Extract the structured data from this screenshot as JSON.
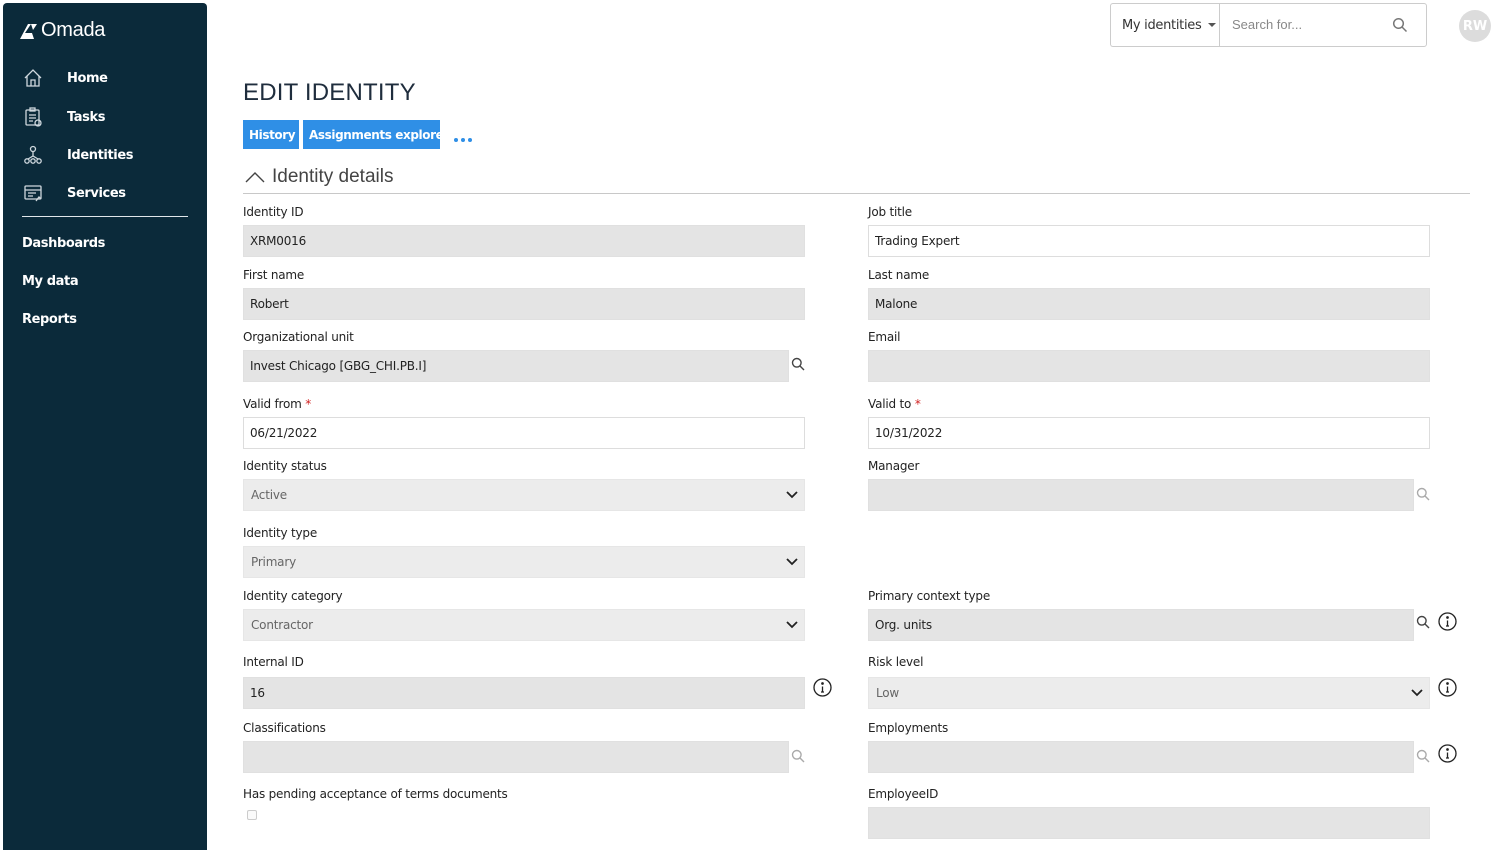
{
  "app": {
    "logo_text": "Omada"
  },
  "sidebar": {
    "items": [
      {
        "label": "Home",
        "icon": "home-icon"
      },
      {
        "label": "Tasks",
        "icon": "tasks-icon"
      },
      {
        "label": "Identities",
        "icon": "identities-icon"
      },
      {
        "label": "Services",
        "icon": "services-icon"
      }
    ],
    "secondary": [
      "Dashboards",
      "My data",
      "Reports"
    ]
  },
  "topbar": {
    "scope_select": "My identities",
    "search_placeholder": "Search for...",
    "avatar_initials": "RW"
  },
  "page": {
    "title": "EDIT IDENTITY",
    "buttons": {
      "history": "History",
      "assignments": "Assignments explorer"
    },
    "section_title": "Identity details"
  },
  "fields": {
    "identity_id": {
      "label": "Identity ID",
      "value": "XRM0016"
    },
    "job_title": {
      "label": "Job title",
      "value": "Trading Expert"
    },
    "first_name": {
      "label": "First name",
      "value": "Robert"
    },
    "last_name": {
      "label": "Last name",
      "value": "Malone"
    },
    "org_unit": {
      "label": "Organizational unit",
      "value": "Invest Chicago [GBG_CHI.PB.I]"
    },
    "email": {
      "label": "Email",
      "value": ""
    },
    "valid_from": {
      "label": "Valid from",
      "value": "06/21/2022"
    },
    "valid_to": {
      "label": "Valid to",
      "value": "10/31/2022"
    },
    "identity_status": {
      "label": "Identity status",
      "value": "Active"
    },
    "manager": {
      "label": "Manager",
      "value": ""
    },
    "identity_type": {
      "label": "Identity type",
      "value": "Primary"
    },
    "identity_category": {
      "label": "Identity category",
      "value": "Contractor"
    },
    "primary_context_type": {
      "label": "Primary context type",
      "value": "Org. units"
    },
    "internal_id": {
      "label": "Internal ID",
      "value": "16"
    },
    "risk_level": {
      "label": "Risk level",
      "value": "Low"
    },
    "classifications": {
      "label": "Classifications",
      "value": ""
    },
    "employments": {
      "label": "Employments",
      "value": ""
    },
    "pending_terms": {
      "label": "Has pending acceptance of terms documents",
      "checked": false
    },
    "employee_id": {
      "label": "EmployeeID",
      "value": ""
    }
  },
  "required_marker": "*",
  "colors": {
    "sidebar": "#0b2a3a",
    "accent": "#2f8fe6",
    "field_bg": "#e4e4e4",
    "required": "#d02020"
  }
}
